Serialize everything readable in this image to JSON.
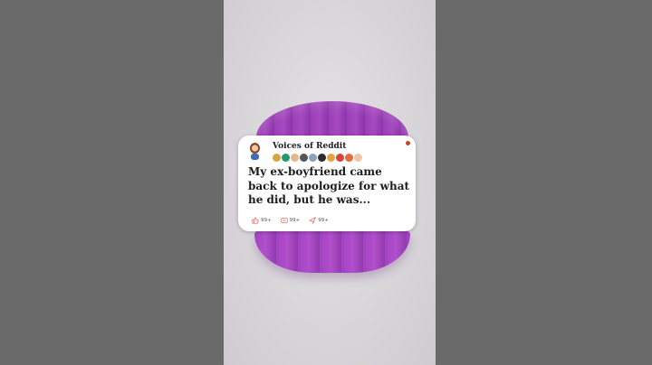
{
  "card": {
    "channel_name": "Voices of Reddit",
    "title": "My ex-boyfriend came back to apologize for what he did, but he was...",
    "upvotes": "99+",
    "comments": "99+",
    "shares": "99+"
  },
  "badges": [
    {
      "name": "award-badge-1",
      "color": "#d8a441"
    },
    {
      "name": "award-badge-2",
      "color": "#1f9a6a"
    },
    {
      "name": "award-badge-3",
      "color": "#e8b48a"
    },
    {
      "name": "award-badge-4",
      "color": "#555555"
    },
    {
      "name": "award-badge-5",
      "color": "#8aa3b8"
    },
    {
      "name": "award-badge-6",
      "color": "#2b2b2b"
    },
    {
      "name": "award-badge-7",
      "color": "#e6a53a"
    },
    {
      "name": "award-badge-8",
      "color": "#d8433a"
    },
    {
      "name": "award-badge-9",
      "color": "#e86a3a"
    },
    {
      "name": "award-badge-10",
      "color": "#f0c6a0"
    }
  ],
  "colors": {
    "accent": "#c0492b",
    "slime": "#a54ac0"
  }
}
